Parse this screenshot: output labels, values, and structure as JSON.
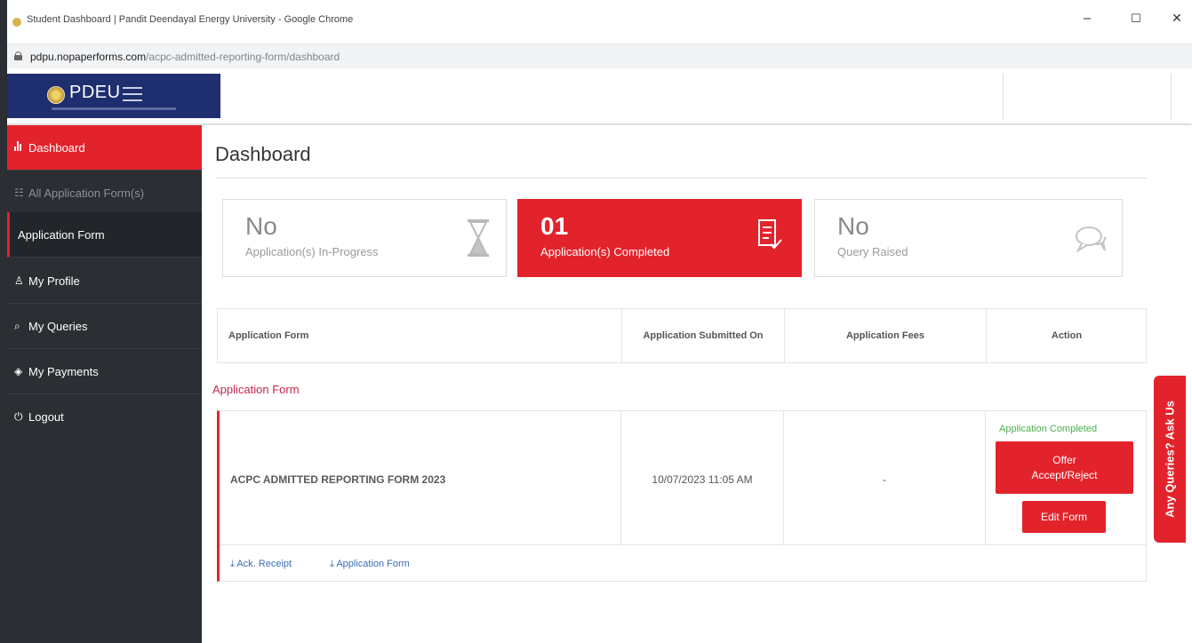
{
  "browser": {
    "window_title": "Student Dashboard | Pandit Deendayal Energy University - Google Chrome",
    "url_host": "pdpu.nopaperforms.com",
    "url_path": "/acpc-admitted-reporting-form/dashboard",
    "minimize": "–",
    "maximize": "☐",
    "close": "✕"
  },
  "header": {
    "logo_text": "PDEU"
  },
  "sidebar": {
    "items": [
      {
        "label": "Dashboard",
        "icon": "bar-chart-icon"
      },
      {
        "label": "All Application Form(s)",
        "icon": "form-icon"
      },
      {
        "label": "Application Form"
      },
      {
        "label": "My Profile",
        "icon": "user-icon"
      },
      {
        "label": "My Queries",
        "icon": "chat-icon"
      },
      {
        "label": "My Payments",
        "icon": "payment-icon"
      },
      {
        "label": "Logout",
        "icon": "power-icon"
      }
    ]
  },
  "main": {
    "title": "Dashboard",
    "cards": [
      {
        "value": "No",
        "label": "Application(s) In-Progress",
        "icon": "hourglass-icon"
      },
      {
        "value": "01",
        "label": "Application(s) Completed",
        "icon": "document-check-icon"
      },
      {
        "value": "No",
        "label": "Query Raised",
        "icon": "speech-bubbles-icon"
      }
    ],
    "table": {
      "headers": [
        "Application Form",
        "Application Submitted On",
        "Application Fees",
        "Action"
      ],
      "section_label": "Application Form",
      "row": {
        "form_name": "ACPC ADMITTED REPORTING FORM 2023",
        "submitted_on": "10/07/2023 11:05 AM",
        "fees": "-",
        "status": "Application Completed",
        "offer_button": "Offer Accept/Reject",
        "edit_button": "Edit Form",
        "links": [
          "Ack. Receipt",
          "Application Form"
        ]
      }
    }
  },
  "ask_tab": "Any Queries? Ask Us",
  "colors": {
    "accent_red": "#e3232c",
    "sidebar_bg": "#2b2e33",
    "success_green": "#4caf50",
    "link_blue": "#3c6db3"
  }
}
